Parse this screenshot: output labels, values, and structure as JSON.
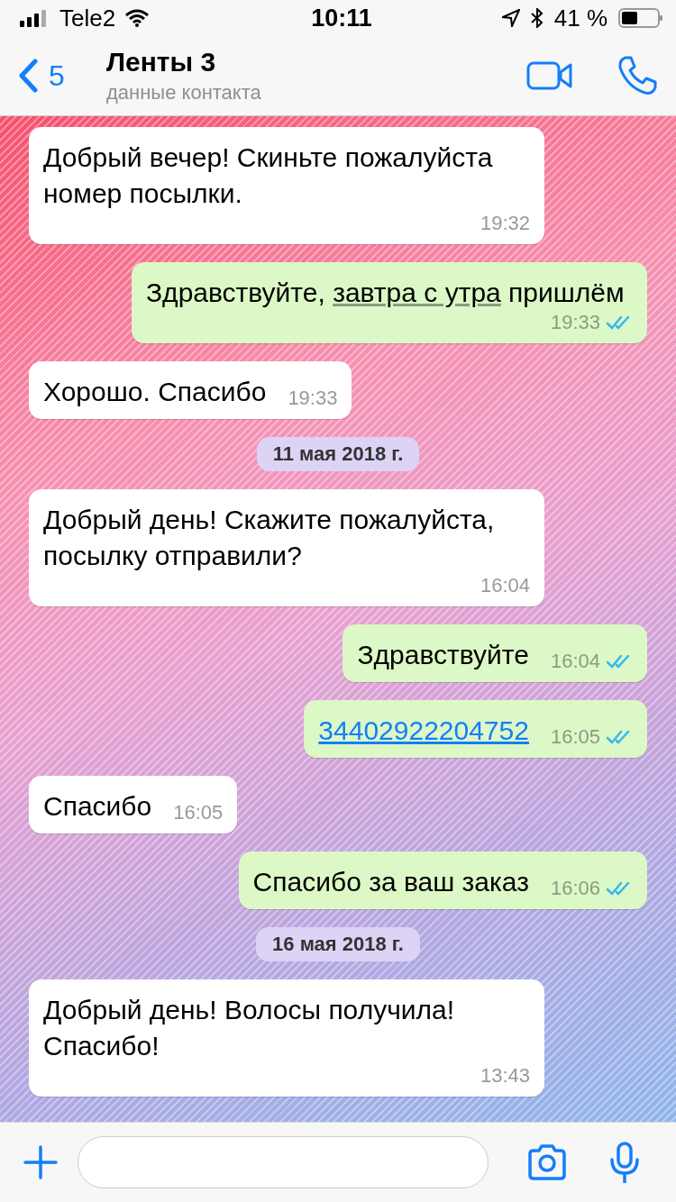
{
  "status_bar": {
    "carrier": "Tele2",
    "time": "10:11",
    "battery": "41 %"
  },
  "header": {
    "back_count": "5",
    "title": "Ленты 3",
    "subtitle": "данные контакта"
  },
  "messages": [
    {
      "kind": "incoming",
      "parts": [
        {
          "kind": "plain",
          "text": "Добрый вечер! Скиньте пожалуйста номер посылки."
        }
      ],
      "time": "19:32"
    },
    {
      "kind": "outgoing",
      "parts": [
        {
          "kind": "plain",
          "text": "Здравствуйте, "
        },
        {
          "kind": "detected",
          "text": "завтра с утра"
        },
        {
          "kind": "plain",
          "text": " пришлём"
        }
      ],
      "time": "19:33",
      "read": true
    },
    {
      "kind": "incoming",
      "parts": [
        {
          "kind": "plain",
          "text": "Хорошо. Спасибо"
        }
      ],
      "time": "19:33"
    },
    {
      "kind": "date",
      "text": "11 мая 2018 г."
    },
    {
      "kind": "incoming",
      "parts": [
        {
          "kind": "plain",
          "text": "Добрый день! Скажите пожалуйста, посылку отправили?"
        }
      ],
      "time": "16:04"
    },
    {
      "kind": "outgoing",
      "parts": [
        {
          "kind": "plain",
          "text": "Здравствуйте"
        }
      ],
      "time": "16:04",
      "read": true
    },
    {
      "kind": "outgoing",
      "parts": [
        {
          "kind": "link",
          "text": "34402922204752"
        }
      ],
      "time": "16:05",
      "read": true
    },
    {
      "kind": "incoming",
      "parts": [
        {
          "kind": "plain",
          "text": "Спасибо"
        }
      ],
      "time": "16:05"
    },
    {
      "kind": "outgoing",
      "parts": [
        {
          "kind": "plain",
          "text": "Спасибо за ваш заказ"
        }
      ],
      "time": "16:06",
      "read": true
    },
    {
      "kind": "date",
      "text": "16 мая 2018 г."
    },
    {
      "kind": "incoming",
      "parts": [
        {
          "kind": "plain",
          "text": "Добрый день! Волосы получила! Спасибо!"
        }
      ],
      "time": "13:43"
    }
  ]
}
